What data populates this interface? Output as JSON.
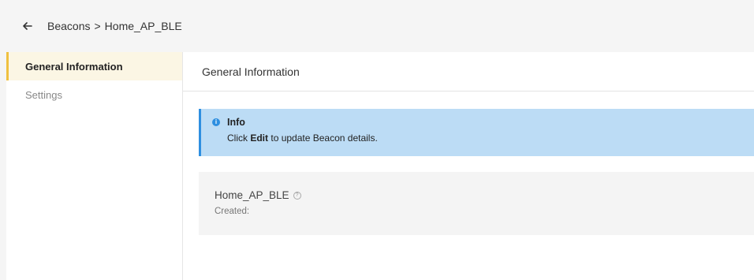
{
  "breadcrumb": {
    "parent": "Beacons",
    "separator": ">",
    "current": "Home_AP_BLE"
  },
  "sidebar": {
    "items": [
      {
        "label": "General Information",
        "active": true
      },
      {
        "label": "Settings",
        "active": false
      }
    ]
  },
  "main": {
    "section_title": "General Information",
    "info": {
      "title": "Info",
      "text_prefix": "Click",
      "text_bold": "Edit",
      "text_suffix": "to update Beacon details."
    },
    "details": {
      "name": "Home_AP_BLE",
      "created_label": "Created:"
    }
  },
  "icons": {
    "back": "arrow-left-icon",
    "info": "info-circle-icon",
    "help": "question-circle-icon"
  },
  "colors": {
    "active_accent": "#f0c040",
    "info_background": "#bcdcf5",
    "info_accent": "#2e8fe0"
  }
}
